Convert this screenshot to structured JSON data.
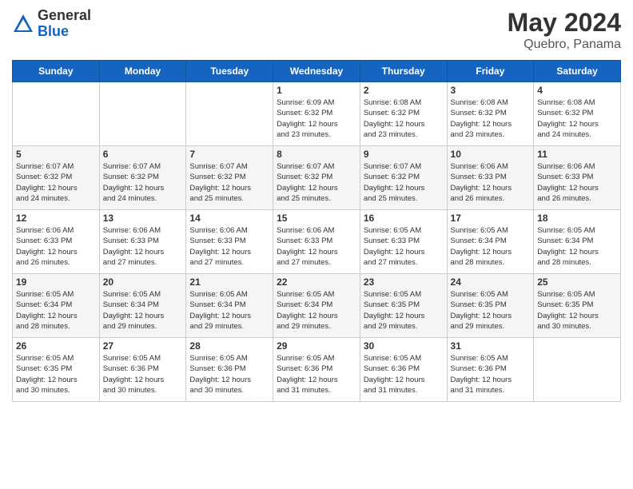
{
  "logo": {
    "general": "General",
    "blue": "Blue"
  },
  "title": {
    "month_year": "May 2024",
    "location": "Quebro, Panama"
  },
  "days_header": [
    "Sunday",
    "Monday",
    "Tuesday",
    "Wednesday",
    "Thursday",
    "Friday",
    "Saturday"
  ],
  "weeks": [
    [
      {
        "day": "",
        "info": ""
      },
      {
        "day": "",
        "info": ""
      },
      {
        "day": "",
        "info": ""
      },
      {
        "day": "1",
        "info": "Sunrise: 6:09 AM\nSunset: 6:32 PM\nDaylight: 12 hours\nand 23 minutes."
      },
      {
        "day": "2",
        "info": "Sunrise: 6:08 AM\nSunset: 6:32 PM\nDaylight: 12 hours\nand 23 minutes."
      },
      {
        "day": "3",
        "info": "Sunrise: 6:08 AM\nSunset: 6:32 PM\nDaylight: 12 hours\nand 23 minutes."
      },
      {
        "day": "4",
        "info": "Sunrise: 6:08 AM\nSunset: 6:32 PM\nDaylight: 12 hours\nand 24 minutes."
      }
    ],
    [
      {
        "day": "5",
        "info": "Sunrise: 6:07 AM\nSunset: 6:32 PM\nDaylight: 12 hours\nand 24 minutes."
      },
      {
        "day": "6",
        "info": "Sunrise: 6:07 AM\nSunset: 6:32 PM\nDaylight: 12 hours\nand 24 minutes."
      },
      {
        "day": "7",
        "info": "Sunrise: 6:07 AM\nSunset: 6:32 PM\nDaylight: 12 hours\nand 25 minutes."
      },
      {
        "day": "8",
        "info": "Sunrise: 6:07 AM\nSunset: 6:32 PM\nDaylight: 12 hours\nand 25 minutes."
      },
      {
        "day": "9",
        "info": "Sunrise: 6:07 AM\nSunset: 6:32 PM\nDaylight: 12 hours\nand 25 minutes."
      },
      {
        "day": "10",
        "info": "Sunrise: 6:06 AM\nSunset: 6:33 PM\nDaylight: 12 hours\nand 26 minutes."
      },
      {
        "day": "11",
        "info": "Sunrise: 6:06 AM\nSunset: 6:33 PM\nDaylight: 12 hours\nand 26 minutes."
      }
    ],
    [
      {
        "day": "12",
        "info": "Sunrise: 6:06 AM\nSunset: 6:33 PM\nDaylight: 12 hours\nand 26 minutes."
      },
      {
        "day": "13",
        "info": "Sunrise: 6:06 AM\nSunset: 6:33 PM\nDaylight: 12 hours\nand 27 minutes."
      },
      {
        "day": "14",
        "info": "Sunrise: 6:06 AM\nSunset: 6:33 PM\nDaylight: 12 hours\nand 27 minutes."
      },
      {
        "day": "15",
        "info": "Sunrise: 6:06 AM\nSunset: 6:33 PM\nDaylight: 12 hours\nand 27 minutes."
      },
      {
        "day": "16",
        "info": "Sunrise: 6:05 AM\nSunset: 6:33 PM\nDaylight: 12 hours\nand 27 minutes."
      },
      {
        "day": "17",
        "info": "Sunrise: 6:05 AM\nSunset: 6:34 PM\nDaylight: 12 hours\nand 28 minutes."
      },
      {
        "day": "18",
        "info": "Sunrise: 6:05 AM\nSunset: 6:34 PM\nDaylight: 12 hours\nand 28 minutes."
      }
    ],
    [
      {
        "day": "19",
        "info": "Sunrise: 6:05 AM\nSunset: 6:34 PM\nDaylight: 12 hours\nand 28 minutes."
      },
      {
        "day": "20",
        "info": "Sunrise: 6:05 AM\nSunset: 6:34 PM\nDaylight: 12 hours\nand 29 minutes."
      },
      {
        "day": "21",
        "info": "Sunrise: 6:05 AM\nSunset: 6:34 PM\nDaylight: 12 hours\nand 29 minutes."
      },
      {
        "day": "22",
        "info": "Sunrise: 6:05 AM\nSunset: 6:34 PM\nDaylight: 12 hours\nand 29 minutes."
      },
      {
        "day": "23",
        "info": "Sunrise: 6:05 AM\nSunset: 6:35 PM\nDaylight: 12 hours\nand 29 minutes."
      },
      {
        "day": "24",
        "info": "Sunrise: 6:05 AM\nSunset: 6:35 PM\nDaylight: 12 hours\nand 29 minutes."
      },
      {
        "day": "25",
        "info": "Sunrise: 6:05 AM\nSunset: 6:35 PM\nDaylight: 12 hours\nand 30 minutes."
      }
    ],
    [
      {
        "day": "26",
        "info": "Sunrise: 6:05 AM\nSunset: 6:35 PM\nDaylight: 12 hours\nand 30 minutes."
      },
      {
        "day": "27",
        "info": "Sunrise: 6:05 AM\nSunset: 6:36 PM\nDaylight: 12 hours\nand 30 minutes."
      },
      {
        "day": "28",
        "info": "Sunrise: 6:05 AM\nSunset: 6:36 PM\nDaylight: 12 hours\nand 30 minutes."
      },
      {
        "day": "29",
        "info": "Sunrise: 6:05 AM\nSunset: 6:36 PM\nDaylight: 12 hours\nand 31 minutes."
      },
      {
        "day": "30",
        "info": "Sunrise: 6:05 AM\nSunset: 6:36 PM\nDaylight: 12 hours\nand 31 minutes."
      },
      {
        "day": "31",
        "info": "Sunrise: 6:05 AM\nSunset: 6:36 PM\nDaylight: 12 hours\nand 31 minutes."
      },
      {
        "day": "",
        "info": ""
      }
    ]
  ]
}
